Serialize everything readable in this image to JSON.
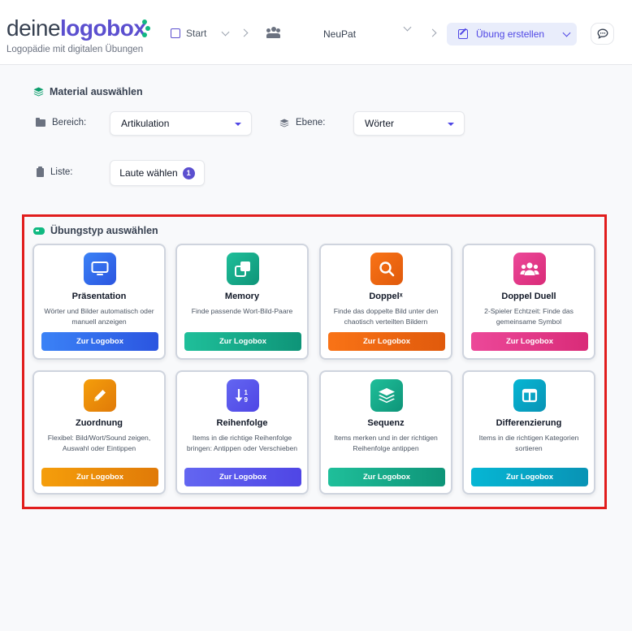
{
  "header": {
    "logo_prefix": "deine",
    "logo_brand": "logobox",
    "tagline": "Logopädie mit digitalen Übungen",
    "nav_start": "Start",
    "nav_user": "NeuPat",
    "create_button": "Übung erstellen"
  },
  "material": {
    "title": "Material auswählen",
    "bereich_label": "Bereich:",
    "bereich_value": "Artikulation",
    "ebene_label": "Ebene:",
    "ebene_value": "Wörter",
    "liste_label": "Liste:",
    "laute_button": "Laute wählen",
    "laute_count": "1"
  },
  "types": {
    "title": "Übungstyp auswählen",
    "button_label": "Zur Logobox",
    "items": [
      {
        "title": "Präsentation",
        "desc": "Wörter und Bilder automatisch oder manuell anzeigen",
        "icon": "monitor-icon",
        "color": "#3b63ea"
      },
      {
        "title": "Memory",
        "desc": "Finde passende Wort-Bild-Paare",
        "icon": "copy-icon",
        "color": "#16a58a"
      },
      {
        "title": "Doppelˣ",
        "desc": "Finde das doppelte Bild unter den chaotisch verteilten Bildern",
        "icon": "search-icon",
        "color": "#f06a12"
      },
      {
        "title": "Doppel Duell",
        "desc": "2-Spieler Echtzeit: Finde das gemeinsame Symbol",
        "icon": "users-icon",
        "color": "#e63f8c"
      },
      {
        "title": "Zuordnung",
        "desc": "Flexibel: Bild/Wort/Sound zeigen, Auswahl oder Eintippen",
        "icon": "pencil-icon",
        "color": "#ed8a0c"
      },
      {
        "title": "Reihenfolge",
        "desc": "Items in die richtige Reihenfolge bringen: Antippen oder Verschieben",
        "icon": "sort-icon",
        "color": "#5b55e8"
      },
      {
        "title": "Sequenz",
        "desc": "Items merken und in der richtigen Reihenfolge antippen",
        "icon": "layers-icon",
        "color": "#16a58a"
      },
      {
        "title": "Differenzierung",
        "desc": "Items in die richtigen Kategorien sortieren",
        "icon": "columns-icon",
        "color": "#0fa8c7"
      }
    ]
  }
}
